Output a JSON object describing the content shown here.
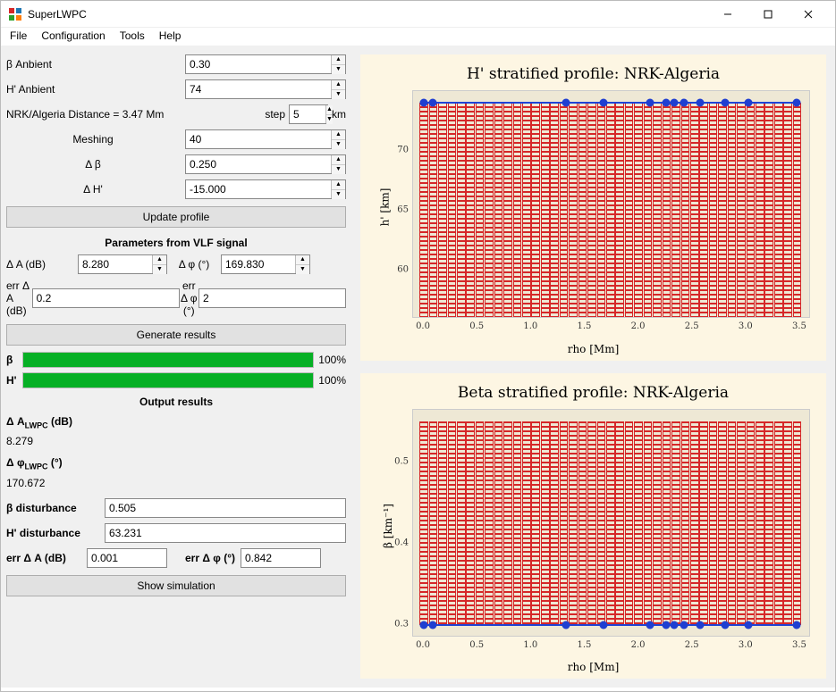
{
  "window": {
    "title": "SuperLWPC"
  },
  "menu": {
    "file": "File",
    "configuration": "Configuration",
    "tools": "Tools",
    "help": "Help"
  },
  "params": {
    "beta_ambient_label": "β Anbient",
    "beta_ambient_value": "0.30",
    "h_ambient_label": "H' Anbient",
    "h_ambient_value": "74",
    "distance_label": "NRK/Algeria Distance = 3.47 Mm",
    "step_label": "step",
    "step_value": "5",
    "step_unit": "km",
    "meshing_label": "Meshing",
    "meshing_value": "40",
    "dbeta_label": "Δ β",
    "dbeta_value": "0.250",
    "dh_label": "Δ H'",
    "dh_value": "-15.000",
    "update_profile_btn": "Update profile"
  },
  "vlf": {
    "section_title": "Parameters from VLF signal",
    "dA_label": "Δ A (dB)",
    "dA_value": "8.280",
    "dphi_label": "Δ φ (°)",
    "dphi_value": "169.830",
    "err_dA_label": "err Δ A (dB)",
    "err_dA_value": "0.2",
    "err_dphi_label": "err Δ φ (°)",
    "err_dphi_value": "2",
    "generate_btn": "Generate results"
  },
  "progress": {
    "beta_label": "β",
    "beta_pct": "100%",
    "h_label": "H'",
    "h_pct": "100%"
  },
  "output": {
    "section_title": "Output results",
    "dA_lwpc_label": "Δ A",
    "dA_lwpc_sub": "LWPC",
    "dA_lwpc_unit": " (dB)",
    "dA_lwpc_value": "8.279",
    "dphi_lwpc_label": "Δ φ",
    "dphi_lwpc_sub": "LWPC",
    "dphi_lwpc_unit": " (°)",
    "dphi_lwpc_value": "170.672",
    "beta_dist_label": "β disturbance",
    "beta_dist_value": "0.505",
    "h_dist_label": "H' disturbance",
    "h_dist_value": "63.231",
    "err_dA_label": "err Δ A (dB)",
    "err_dA_value": "0.001",
    "err_dphi_label": "err Δ φ (°)",
    "err_dphi_value": "0.842",
    "show_sim_btn": "Show simulation"
  },
  "chart_data": [
    {
      "type": "bar",
      "title": "H' stratified profile: NRK-Algeria",
      "xlabel": "rho [Mm]",
      "ylabel": "h' [km]",
      "x_ticks": [
        0.0,
        0.5,
        1.0,
        1.5,
        2.0,
        2.5,
        3.0,
        3.5
      ],
      "y_ticks": [
        60,
        65,
        70
      ],
      "xlim": [
        -0.1,
        3.6
      ],
      "ylim": [
        56,
        75
      ],
      "bar_x_step": 0.0868,
      "bar_count": 41,
      "bar_y": 74,
      "line_y": 74,
      "markers_x": [
        0.0,
        0.087,
        1.32,
        1.67,
        2.1,
        2.25,
        2.33,
        2.42,
        2.57,
        2.8,
        3.02,
        3.47
      ]
    },
    {
      "type": "bar",
      "title": "Beta stratified profile: NRK-Algeria",
      "xlabel": "rho [Mm]",
      "ylabel": "β [km⁻¹]",
      "x_ticks": [
        0.0,
        0.5,
        1.0,
        1.5,
        2.0,
        2.5,
        3.0,
        3.5
      ],
      "y_ticks": [
        0.3,
        0.4,
        0.5
      ],
      "xlim": [
        -0.1,
        3.6
      ],
      "ylim": [
        0.285,
        0.565
      ],
      "bar_x_step": 0.0868,
      "bar_count": 41,
      "bar_ymin": 0.3,
      "bar_ymax": 0.55,
      "line_y": 0.3,
      "markers_x": [
        0.0,
        0.087,
        1.32,
        1.67,
        2.1,
        2.25,
        2.33,
        2.42,
        2.57,
        2.8,
        3.02,
        3.47
      ]
    }
  ]
}
